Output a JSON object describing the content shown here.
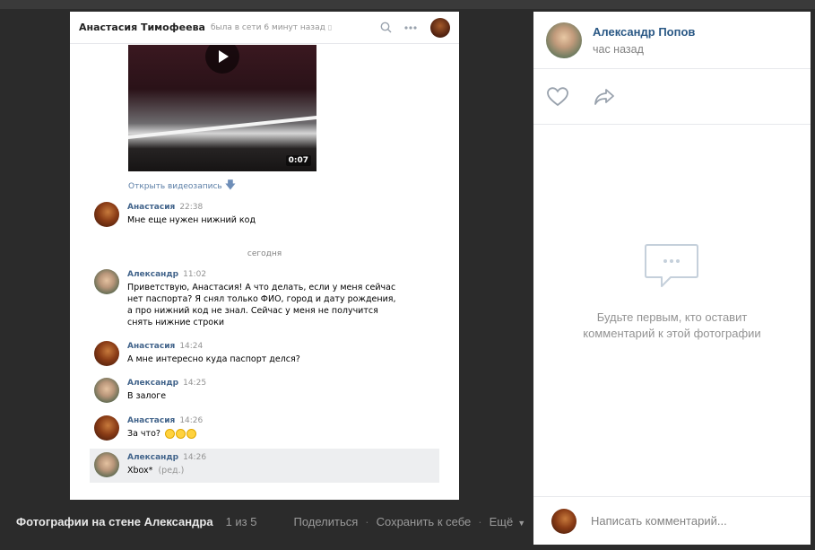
{
  "chat": {
    "header": {
      "name": "Анастасия Тимофеева",
      "status": "была в сети 6 минут назад",
      "status_icon": "phone-icon",
      "search_icon": "search-icon",
      "more_icon": "more-icon"
    },
    "video": {
      "duration": "0:07",
      "open_label": "Открыть видеозапись"
    },
    "day_separator": "сегодня",
    "messages": [
      {
        "author": "Анастасия",
        "time": "22:38",
        "text": "Мне еще нужен нижний код"
      },
      {
        "author": "Александр",
        "time": "11:02",
        "text": "Приветствую, Анастасия! А что делать, если у меня сейчас нет паспорта? Я снял только ФИО, город и дату рождения, а про нижний код не знал. Сейчас у меня не получится снять нижние строки"
      },
      {
        "author": "Анастасия",
        "time": "14:24",
        "text": "А мне интересно куда паспорт делся?"
      },
      {
        "author": "Александр",
        "time": "14:25",
        "text": "В залоге"
      },
      {
        "author": "Анастасия",
        "time": "14:26",
        "text": "За что?",
        "emoji_count": 3
      },
      {
        "author": "Александр",
        "time": "14:26",
        "text": "Xbox*",
        "edited": "(ред.)"
      }
    ]
  },
  "post": {
    "author_name": "Александр Попов",
    "time": "час назад",
    "like_icon": "heart-icon",
    "share_icon": "share-icon",
    "empty_comments_icon": "comments-icon",
    "empty_comments_line1": "Будьте первым, кто оставит",
    "empty_comments_line2": "комментарий к этой фотографии",
    "comment_placeholder": "Написать комментарий..."
  },
  "bottom_bar": {
    "album_title": "Фотографии на стене Александра",
    "counter": "1 из 5",
    "share_label": "Поделиться",
    "save_label": "Сохранить к себе",
    "more_label": "Ещё"
  }
}
